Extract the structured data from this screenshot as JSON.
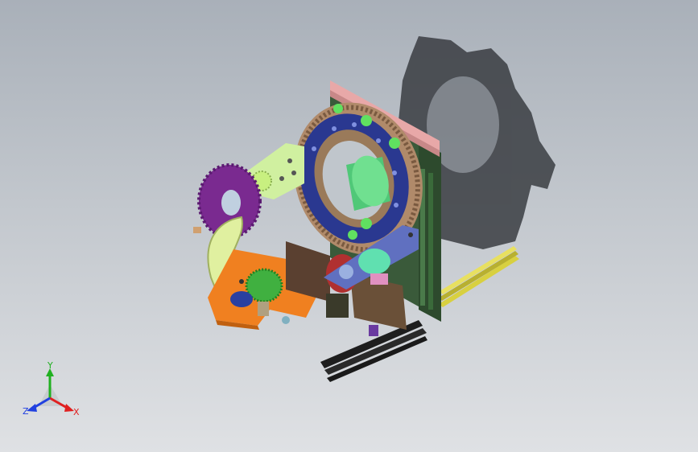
{
  "viewport": {
    "background_top": "#a9b0b9",
    "background_bottom": "#dfe1e4"
  },
  "triad": {
    "x_label": "X",
    "y_label": "Y",
    "z_label": "Z",
    "x_color": "#e02020",
    "y_color": "#20b020",
    "z_color": "#2040e0"
  },
  "model": {
    "icons": [
      "large-ring-gear-icon",
      "purple-spur-gear-icon",
      "green-spur-gear-icon",
      "motor-icon",
      "rail-icon",
      "shadow-icon"
    ],
    "colors": {
      "ring_gear": "#b08a6a",
      "ring_inner": "#2a3890",
      "purple_gear": "#7a2a90",
      "orange_plate": "#f08020",
      "motor": "#60e0b0",
      "rails": "#2a2a2a",
      "yellow_rails": "#d8d040",
      "frame": "#3a6a3a",
      "bracket": "#d0f0a0",
      "mount_plate": "#6070c0"
    }
  }
}
